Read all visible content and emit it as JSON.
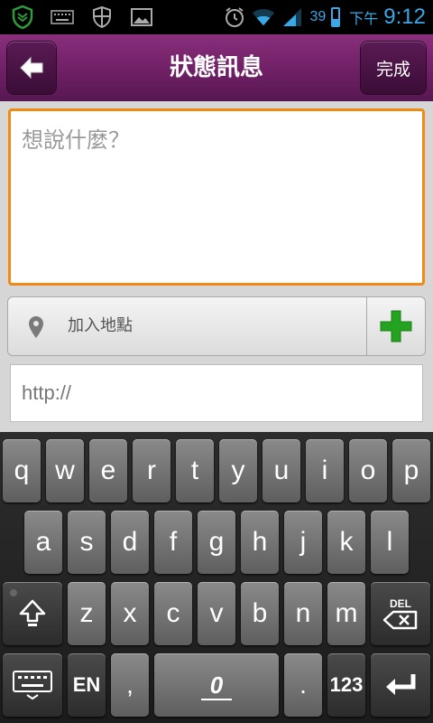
{
  "statusbar": {
    "battery_level": "39",
    "ampm": "下午",
    "time": "9:12",
    "left_icons": [
      "shield-icon",
      "keyboard-icon",
      "security-icon",
      "image-icon"
    ],
    "right_icons": [
      "alarm-icon",
      "wifi-icon",
      "signal-icon",
      "battery-icon"
    ]
  },
  "titlebar": {
    "title": "狀態訊息",
    "done_label": "完成"
  },
  "compose": {
    "status_placeholder": "想說什麼？",
    "location_label": "加入地點",
    "url_placeholder": "http://"
  },
  "keyboard": {
    "row1": [
      "q",
      "w",
      "e",
      "r",
      "t",
      "y",
      "u",
      "i",
      "o",
      "p"
    ],
    "row2": [
      "a",
      "s",
      "d",
      "f",
      "g",
      "h",
      "j",
      "k",
      "l"
    ],
    "row3": [
      "z",
      "x",
      "c",
      "v",
      "b",
      "n",
      "m"
    ],
    "del_label": "DEL",
    "lang_label": "EN",
    "comma": ",",
    "space_label": "0",
    "period": ".",
    "numbers_label": "123"
  },
  "colors": {
    "accent": "#f08a12",
    "titlebar": "#6c1f63",
    "add_icon": "#23a31f",
    "status_blue": "#3aa7e6"
  }
}
